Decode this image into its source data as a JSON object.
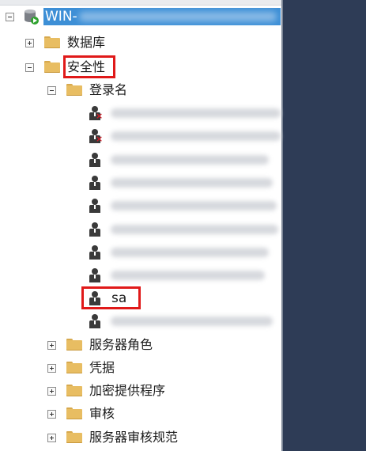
{
  "tree": {
    "server": {
      "label": "WIN-"
    },
    "databases": {
      "label": "数据库"
    },
    "security": {
      "label": "安全性",
      "logins": {
        "label": "登录名",
        "items": [
          "sa"
        ]
      },
      "server_roles": {
        "label": "服务器角色"
      },
      "credentials": {
        "label": "凭据"
      },
      "crypto_providers": {
        "label": "加密提供程序"
      },
      "audits": {
        "label": "审核"
      },
      "audit_specs": {
        "label": "服务器审核规范"
      }
    }
  },
  "colors": {
    "selection": "#3d8fd6",
    "highlight_box": "#e01919",
    "folder": "#e8bd62",
    "right_panel": "#2e3c56"
  },
  "icons": {
    "server": "database-server-icon",
    "folder": "folder-icon",
    "login": "user-icon",
    "disabled_login": "user-disabled-icon"
  }
}
